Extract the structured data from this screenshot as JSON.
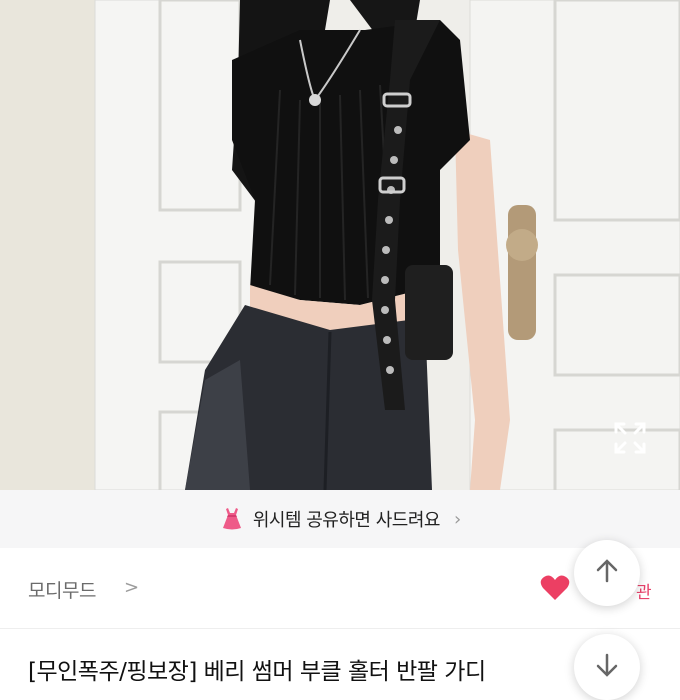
{
  "banner": {
    "text": "위시템 공유하면 사드려요",
    "chevron": "›",
    "icon": "pink-dress-icon"
  },
  "shop": {
    "name": "모디무드",
    "chevron": ">"
  },
  "like": {
    "count_suffix": "관"
  },
  "product": {
    "title": "[무인폭주/핑보장] 베리 썸머 부클 홀터 반팔 가디"
  },
  "colors": {
    "accent": "#ec3f63",
    "banner_bg": "#f6f6f7",
    "text_muted": "#6b6b6b"
  },
  "icons": {
    "expand": "expand-icon",
    "scroll_up": "arrow-up-icon",
    "scroll_down": "arrow-down-icon",
    "like": "heart-icon"
  }
}
